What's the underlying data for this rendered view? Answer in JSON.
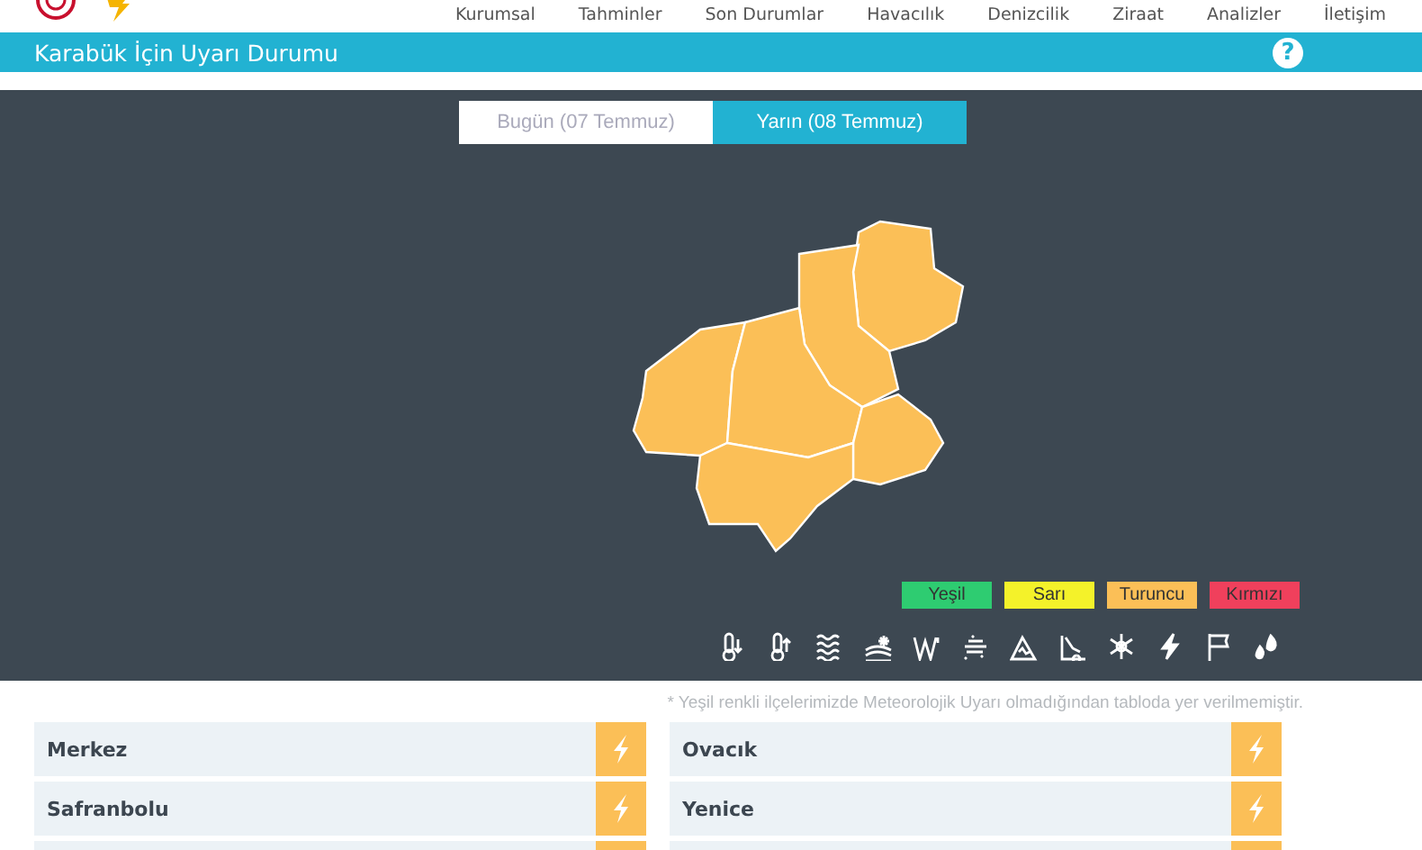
{
  "nav": {
    "items": [
      "Kurumsal",
      "Tahminler",
      "Son Durumlar",
      "Havacılık",
      "Denizcilik",
      "Ziraat",
      "Analizler",
      "İletişim"
    ]
  },
  "title_bar": {
    "title": "Karabük İçin Uyarı Durumu",
    "help": "?"
  },
  "day_tabs": [
    {
      "label": "Bugün (07 Temmuz)",
      "selected": false
    },
    {
      "label": "Yarın (08 Temmuz)",
      "selected": true
    }
  ],
  "map": {
    "districts": [
      {
        "color": "#fbbf57"
      },
      {
        "color": "#fbbf57"
      },
      {
        "color": "#fbbf57"
      },
      {
        "color": "#fbbf57"
      },
      {
        "color": "#fbbf57"
      },
      {
        "color": "#fbbf57"
      }
    ]
  },
  "legend": [
    {
      "label": "Yeşil",
      "color": "#2ecc71"
    },
    {
      "label": "Sarı",
      "color": "#f4f22a"
    },
    {
      "label": "Turuncu",
      "color": "#fbbf57"
    },
    {
      "label": "Kırmızı",
      "color": "#f0405c"
    }
  ],
  "note": "* Yeşil renkli ilçelerimizde Meteorolojik Uyarı olmadığından tabloda yer verilmemiştir.",
  "districts": [
    {
      "name": "Merkez",
      "color": "#fbbf57"
    },
    {
      "name": "Ovacık",
      "color": "#fbbf57"
    },
    {
      "name": "Safranbolu",
      "color": "#fbbf57"
    },
    {
      "name": "Yenice",
      "color": "#fbbf57"
    }
  ]
}
